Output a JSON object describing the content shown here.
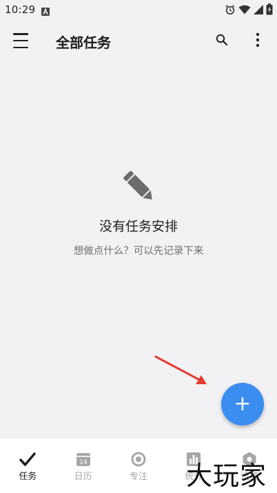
{
  "status_bar": {
    "time": "10:29"
  },
  "app_bar": {
    "title": "全部任务"
  },
  "empty_state": {
    "title": "没有任务安排",
    "subtitle": "想做点什么？可以先记录下来"
  },
  "fab": {
    "label": "+"
  },
  "bottom_nav": {
    "items": [
      {
        "label": "任务",
        "icon": "check-icon",
        "active": true
      },
      {
        "label": "日历",
        "icon": "calendar-icon",
        "day": "14",
        "active": false
      },
      {
        "label": "专注",
        "icon": "focus-icon",
        "active": false
      },
      {
        "label": "统计",
        "icon": "stats-icon",
        "active": false
      },
      {
        "label": "设置",
        "icon": "settings-icon",
        "active": false
      }
    ]
  },
  "watermark": {
    "text": "大玩家"
  },
  "colors": {
    "background": "#f2f2f4",
    "accent": "#3b8df0",
    "annotation_arrow": "#e53a2f",
    "inactive_nav": "#a6a6a6"
  }
}
